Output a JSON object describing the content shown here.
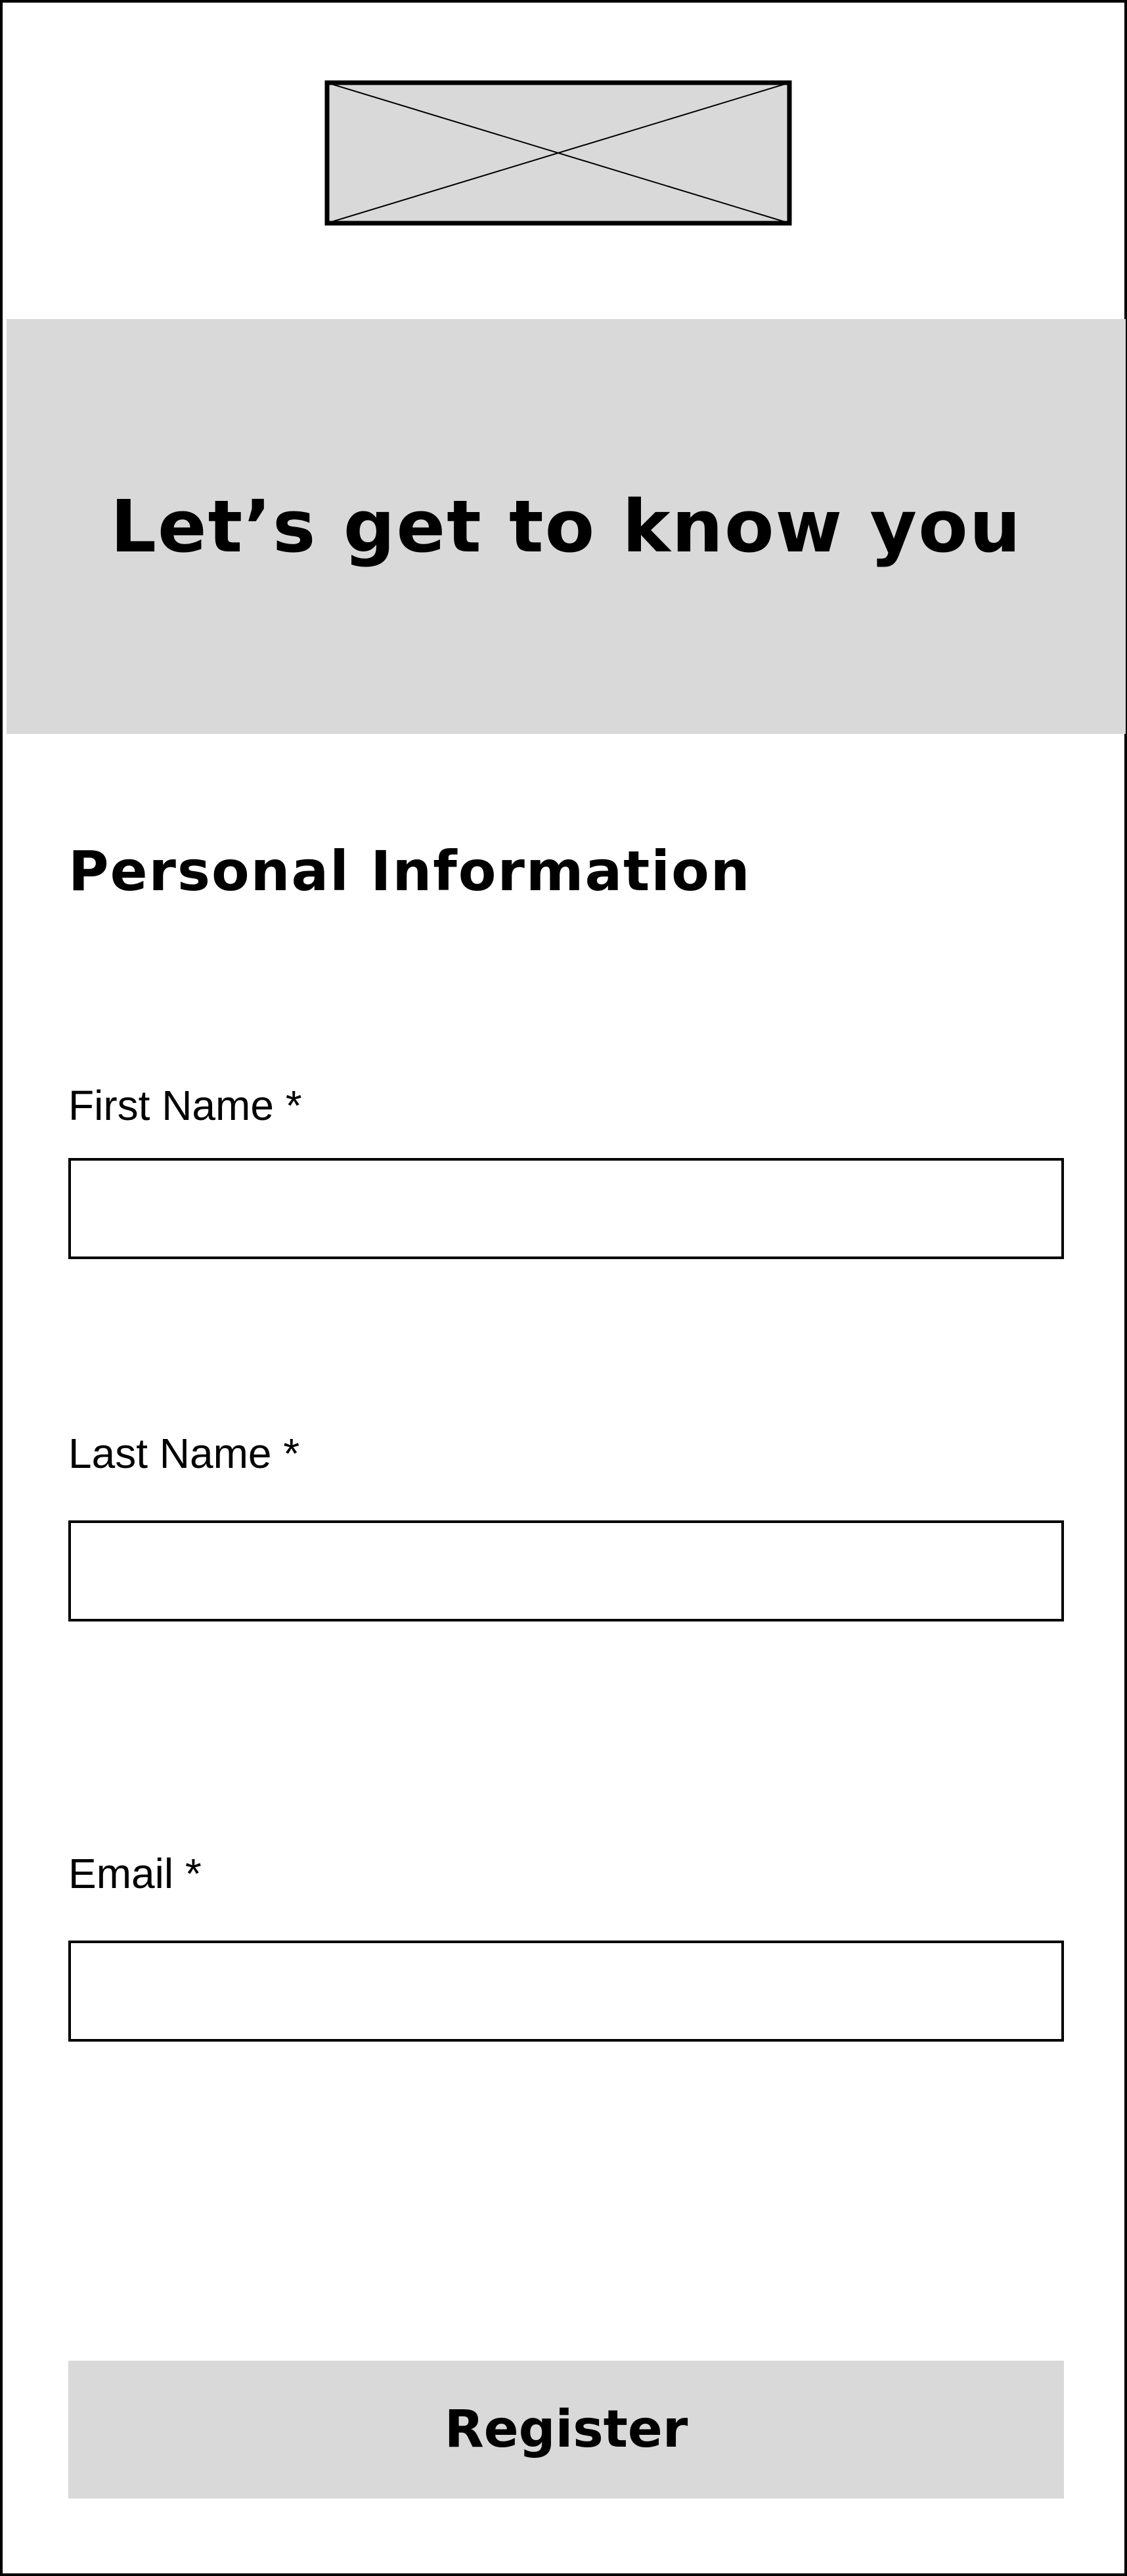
{
  "header": {
    "logo_icon": "image-placeholder-icon"
  },
  "hero": {
    "title": "Let’s get to know you",
    "background": "#d9d9d9"
  },
  "form": {
    "section_title": "Personal Information",
    "fields": [
      {
        "label": "First Name *",
        "value": "",
        "placeholder": ""
      },
      {
        "label": "Last Name *",
        "value": "",
        "placeholder": ""
      },
      {
        "label": "Email *",
        "value": "",
        "placeholder": ""
      }
    ],
    "submit_label": "Register",
    "submit_background": "#d9d9d9"
  }
}
